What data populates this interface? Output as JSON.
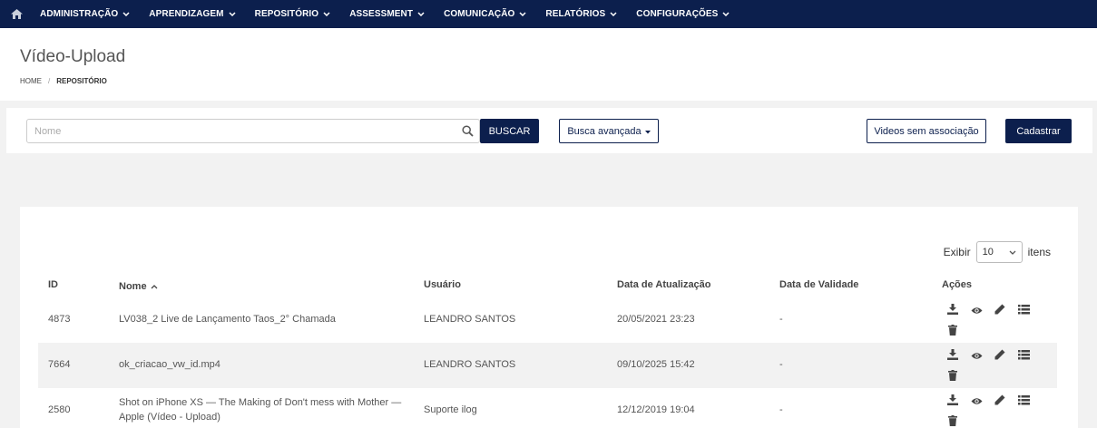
{
  "nav": {
    "items": [
      {
        "label": "ADMINISTRAÇÃO"
      },
      {
        "label": "APRENDIZAGEM"
      },
      {
        "label": "REPOSITÓRIO"
      },
      {
        "label": "ASSESSMENT"
      },
      {
        "label": "COMUNICAÇÃO"
      },
      {
        "label": "RELATÓRIOS"
      },
      {
        "label": "CONFIGURAÇÕES"
      }
    ]
  },
  "header": {
    "title": "Vídeo-Upload",
    "breadcrumb": {
      "home": "HOME",
      "separator": "/",
      "current": "REPOSITÓRIO"
    }
  },
  "search": {
    "placeholder": "Nome",
    "value": "",
    "button": "BUSCAR",
    "advanced": "Busca avançada",
    "videos_sem_associacao": "Videos sem associação",
    "cadastrar": "Cadastrar"
  },
  "table": {
    "exibir_label": "Exibir",
    "page_size": "10",
    "itens_label": "itens",
    "columns": {
      "id": "ID",
      "nome": "Nome",
      "usuario": "Usuário",
      "data_atualizacao": "Data de Atualização",
      "data_validade": "Data de Validade",
      "acoes": "Ações"
    },
    "rows": [
      {
        "id": "4873",
        "nome_line1": "LV038_2 Live de Lançamento Taos_2° Chamada",
        "nome_line2": "",
        "usuario": "LEANDRO SANTOS",
        "data_atualizacao": "20/05/2021 23:23",
        "data_validade": "-"
      },
      {
        "id": "7664",
        "nome_line1": "ok_criacao_vw_id.mp4",
        "nome_line2": "",
        "usuario": "LEANDRO SANTOS",
        "data_atualizacao": "09/10/2025 15:42",
        "data_validade": "-"
      },
      {
        "id": "2580",
        "nome_line1": "Shot on iPhone XS — The Making of Don't mess with Mother —",
        "nome_line2": "Apple (Vídeo - Upload)",
        "usuario": "Suporte ilog",
        "data_atualizacao": "12/12/2019 19:04",
        "data_validade": "-"
      }
    ]
  },
  "colors": {
    "navy": "#0c1f4d",
    "background": "#f2f2f2",
    "row_alt": "#f2f2f2"
  },
  "icons": [
    "home-icon",
    "chevron-down-icon",
    "search-icon",
    "caret-down-icon",
    "download-icon",
    "eye-icon",
    "pencil-icon",
    "list-icon",
    "trash-icon",
    "sort-up-icon"
  ]
}
